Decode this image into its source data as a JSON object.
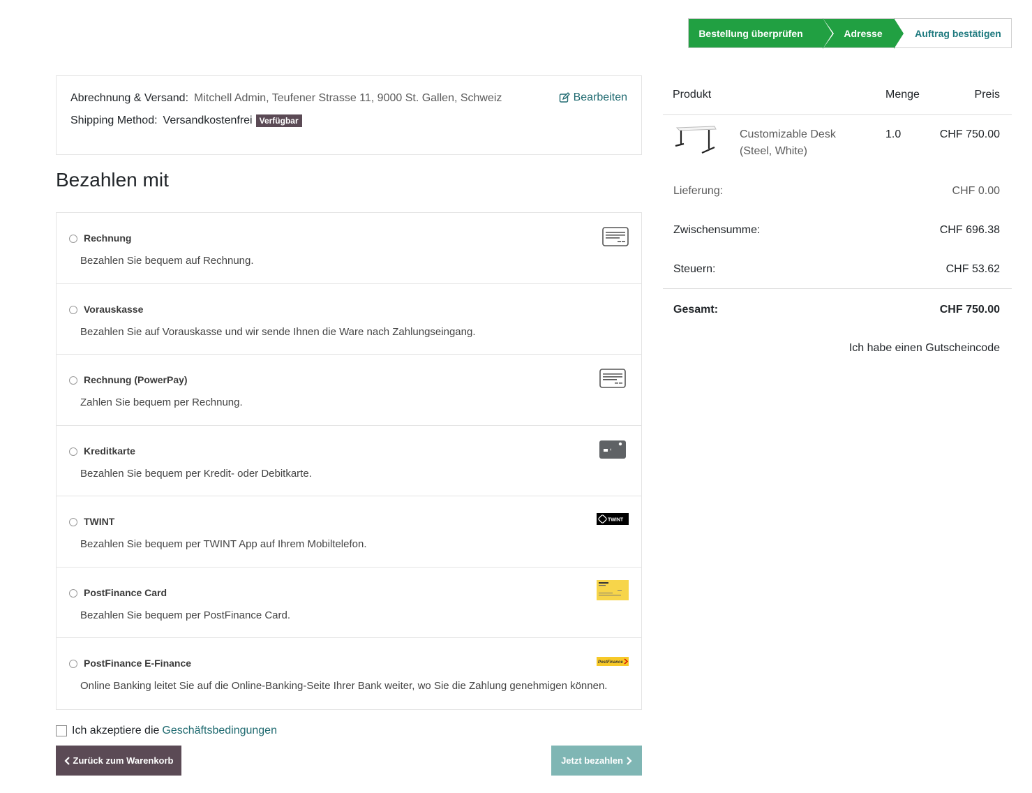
{
  "wizard": {
    "steps": [
      {
        "label": "Bestellung überprüfen"
      },
      {
        "label": "Adresse"
      },
      {
        "label": "Auftrag bestätigen"
      }
    ]
  },
  "address": {
    "billing_label": "Abrechnung & Versand:",
    "billing_value": "Mitchell Admin, Teufener Strasse 11, 9000 St. Gallen, Schweiz",
    "shipping_label": "Shipping Method:",
    "shipping_value": "Versandkostenfrei",
    "shipping_badge": "Verfügbar",
    "edit_label": "Bearbeiten"
  },
  "payment": {
    "title": "Bezahlen mit",
    "methods": [
      {
        "name": "Rechnung",
        "desc": "Bezahlen Sie bequem auf Rechnung.",
        "logo": "invoice-icon"
      },
      {
        "name": "Vorauskasse",
        "desc": "Bezahlen Sie auf Vorauskasse und wir sende Ihnen die Ware nach Zahlungseingang.",
        "logo": ""
      },
      {
        "name": "Rechnung (PowerPay)",
        "desc": "Zahlen Sie bequem per Rechnung.",
        "logo": "invoice-icon"
      },
      {
        "name": "Kreditkarte",
        "desc": "Bezahlen Sie bequem per Kredit- oder Debitkarte.",
        "logo": "credit-card-icon"
      },
      {
        "name": "TWINT",
        "desc": "Bezahlen Sie bequem per TWINT App auf Ihrem Mobiltelefon.",
        "logo": "twint-logo",
        "logo_text": "TWINT"
      },
      {
        "name": "PostFinance Card",
        "desc": "Bezahlen Sie bequem per PostFinance Card.",
        "logo": "postfinance-card-icon"
      },
      {
        "name": "PostFinance E-Finance",
        "desc": "Online Banking leitet Sie auf die Online-Banking-Seite Ihrer Bank weiter, wo Sie die Zahlung genehmigen können.",
        "logo": "postfinance-logo",
        "logo_text": "PostFinance"
      }
    ]
  },
  "terms": {
    "text": "Ich akzeptiere die",
    "link": "Geschäftsbedingungen"
  },
  "buttons": {
    "back": "Zurück zum Warenkorb",
    "pay": "Jetzt bezahlen"
  },
  "summary": {
    "headers": {
      "product": "Produkt",
      "qty": "Menge",
      "price": "Preis"
    },
    "product": {
      "name_line1": "Customizable Desk",
      "name_line2": "(Steel, White)",
      "qty": "1.0",
      "price": "CHF 750.00"
    },
    "rows": {
      "delivery": {
        "label": "Lieferung:",
        "value": "CHF 0.00"
      },
      "subtotal": {
        "label": "Zwischensumme:",
        "value": "CHF 696.38"
      },
      "taxes": {
        "label": "Steuern:",
        "value": "CHF 53.62"
      },
      "total": {
        "label": "Gesamt:",
        "value": "CHF 750.00"
      }
    },
    "voucher": "Ich habe einen Gutscheincode"
  },
  "colors": {
    "wizard_done": "#21a042",
    "link": "#1f6a70",
    "btn_dark": "#5b4a55",
    "btn_teal": "#7fb6b4"
  }
}
